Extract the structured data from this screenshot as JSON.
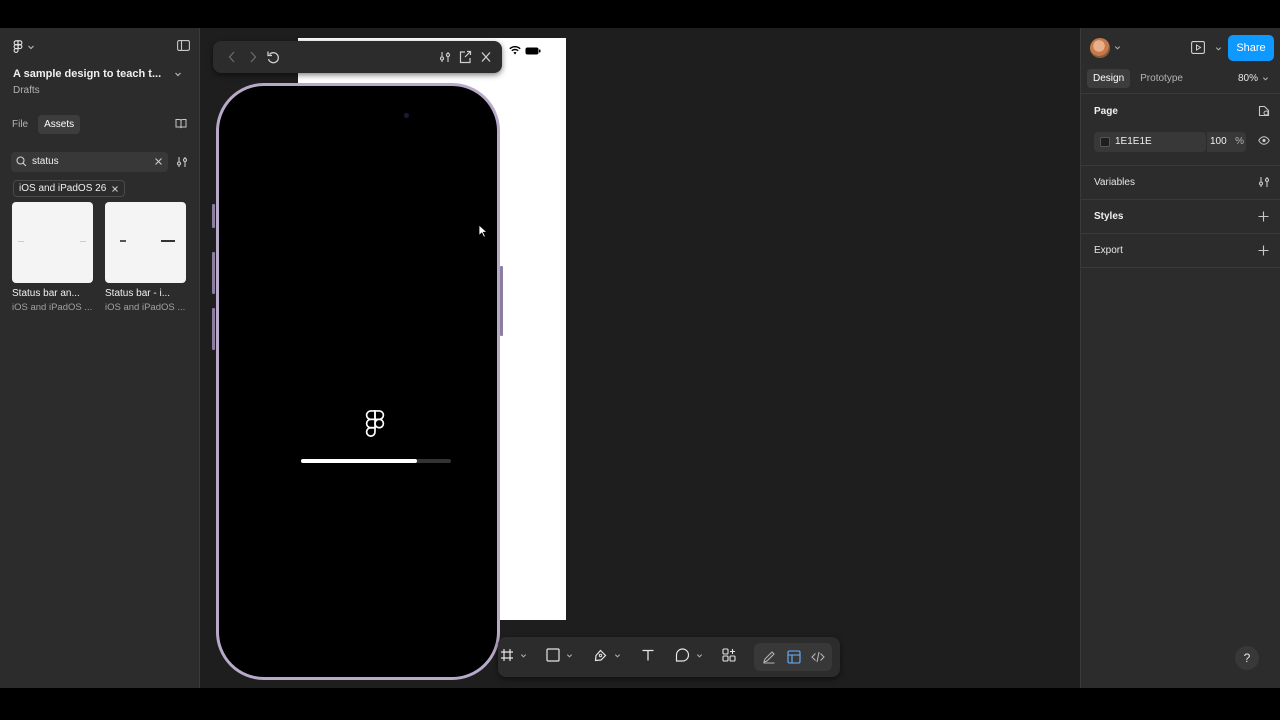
{
  "left_panel": {
    "file_title": "A sample design to teach t...",
    "file_location": "Drafts",
    "tabs": [
      {
        "label": "File",
        "active": false
      },
      {
        "label": "Assets",
        "active": true
      }
    ],
    "search": {
      "value": "status"
    },
    "filter_chip": "iOS and iPadOS 26",
    "assets": [
      {
        "name": "Status bar an...",
        "library": "iOS and iPadOS ..."
      },
      {
        "name": "Status bar - i...",
        "library": "iOS and iPadOS ..."
      }
    ]
  },
  "canvas": {
    "page_background": "#1E1E1E",
    "phone_preview": {
      "loading_progress": 0.77,
      "logo": "figma-logo"
    }
  },
  "bottom_toolbar": {
    "tools": [
      "frame-tool",
      "shape-tool",
      "pen-tool",
      "text-tool",
      "comment-tool",
      "actions-tool",
      "draw-mode",
      "design-mode",
      "dev-mode"
    ]
  },
  "right_panel": {
    "share_label": "Share",
    "tabs": [
      {
        "label": "Design",
        "active": true
      },
      {
        "label": "Prototype",
        "active": false
      }
    ],
    "zoom": "80%",
    "page_section": {
      "title": "Page",
      "color_hex": "1E1E1E",
      "opacity": "100",
      "opacity_unit": "%"
    },
    "variables_label": "Variables",
    "styles_label": "Styles",
    "export_label": "Export",
    "help_label": "?"
  },
  "colors": {
    "accent": "#0d99ff",
    "panel": "#2c2c2c",
    "canvas": "#1e1e1e",
    "phone_frame": "#b9a9c9"
  }
}
